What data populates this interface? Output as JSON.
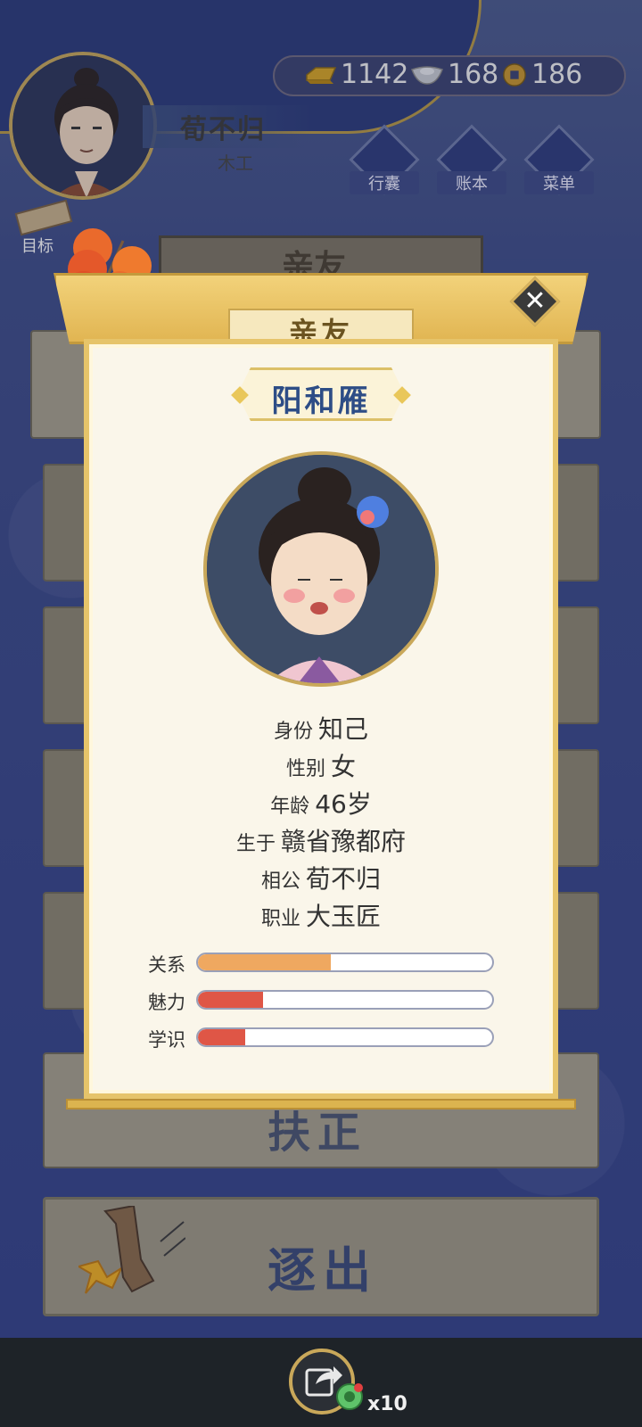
{
  "hud": {
    "player_name": "荀不归",
    "player_role": "木工",
    "currency": {
      "gold": "1142",
      "silver": "168",
      "coin": "186"
    },
    "menu": [
      {
        "label": "行囊",
        "icon": "bag-icon"
      },
      {
        "label": "账本",
        "icon": "ledger-icon"
      },
      {
        "label": "菜单",
        "icon": "more-icon"
      }
    ],
    "goal_label": "目标",
    "bg_header": "亲友"
  },
  "background_cards": {
    "fuzheng": "扶正",
    "expel": "逐出"
  },
  "modal": {
    "title": "亲友",
    "person_name": "阳和雁",
    "info": [
      {
        "key": "身份",
        "value": "知己"
      },
      {
        "key": "性别",
        "value": "女"
      },
      {
        "key": "年龄",
        "value": "46岁"
      },
      {
        "key": "生于",
        "value": "赣省豫都府"
      },
      {
        "key": "相公",
        "value": "荀不归"
      },
      {
        "key": "职业",
        "value": "大玉匠"
      }
    ],
    "stats": [
      {
        "label": "关系",
        "fraction": 0.45,
        "color": "#efa860"
      },
      {
        "label": "魅力",
        "fraction": 0.22,
        "color": "#df5646"
      },
      {
        "label": "学识",
        "fraction": 0.16,
        "color": "#df5646"
      }
    ]
  },
  "bottom": {
    "share_count": "x10"
  }
}
